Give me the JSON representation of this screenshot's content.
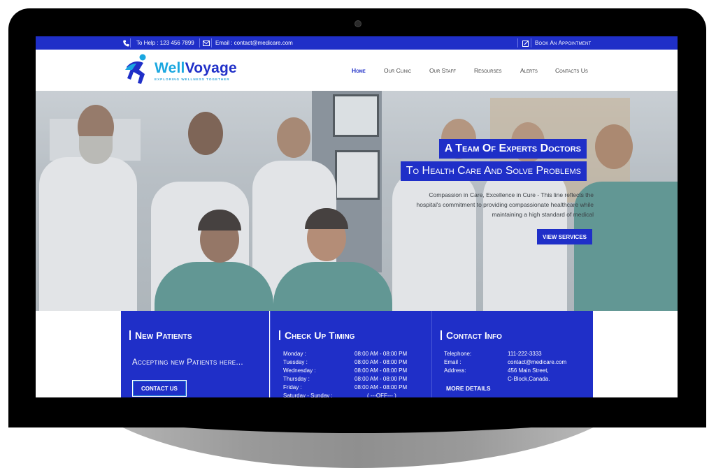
{
  "topbar": {
    "help": "To Help : 123 456 7899",
    "email": "Email : contact@medicare.com",
    "book": "Book An Appointment"
  },
  "brand": {
    "name_part1": "Well",
    "name_part2": "Voyage",
    "tagline": "EXPLORING WELLNESS TOGETHER"
  },
  "nav": {
    "items": [
      "Home",
      "Our Clinic",
      "Our Staff",
      "Resourses",
      "Alerts",
      "Contacts Us"
    ],
    "active": "Home"
  },
  "hero": {
    "headline1": "A Team Of Experts Doctors",
    "headline2": "To Health Care And Solve Problems",
    "desc_line1": "Compassion in Care, Excellence in Cure - This line reflects the",
    "desc_line2": "hospital's commitment to providing compassionate healthcare while",
    "desc_line3": "maintaining a high standard of medical",
    "button": "VIEW SERVICES"
  },
  "new_patients": {
    "title": "New Patients",
    "subtitle": "Accepting new Patients here...",
    "button": "CONTACT US"
  },
  "checkup": {
    "title": "Check Up Timing",
    "rows": [
      {
        "day": "Monday :",
        "time": "08:00 AM - 08:00 PM"
      },
      {
        "day": "Tuesday :",
        "time": "08:00 AM - 08:00 PM"
      },
      {
        "day": "Wednesday :",
        "time": "08:00 AM - 08:00 PM"
      },
      {
        "day": "Thursday :",
        "time": "08:00 AM - 08:00 PM"
      },
      {
        "day": "Friday :",
        "time": "08:00 AM - 08:00 PM"
      },
      {
        "day": "Saturday - Sunday :",
        "time": "( ---OFF--- )"
      }
    ]
  },
  "contact": {
    "title": "Contact Info",
    "telephone_label": "Telephone:",
    "telephone": "111-222-3333",
    "email_label": "Email :",
    "email": "contact@medicare.com",
    "address_label": "Address:",
    "address_line1": "456 Main Street,",
    "address_line2": "C-Block,Canada.",
    "button": "MORE DETAILS"
  },
  "colors": {
    "primary": "#1f2fc8",
    "accent": "#1aa7e0"
  }
}
